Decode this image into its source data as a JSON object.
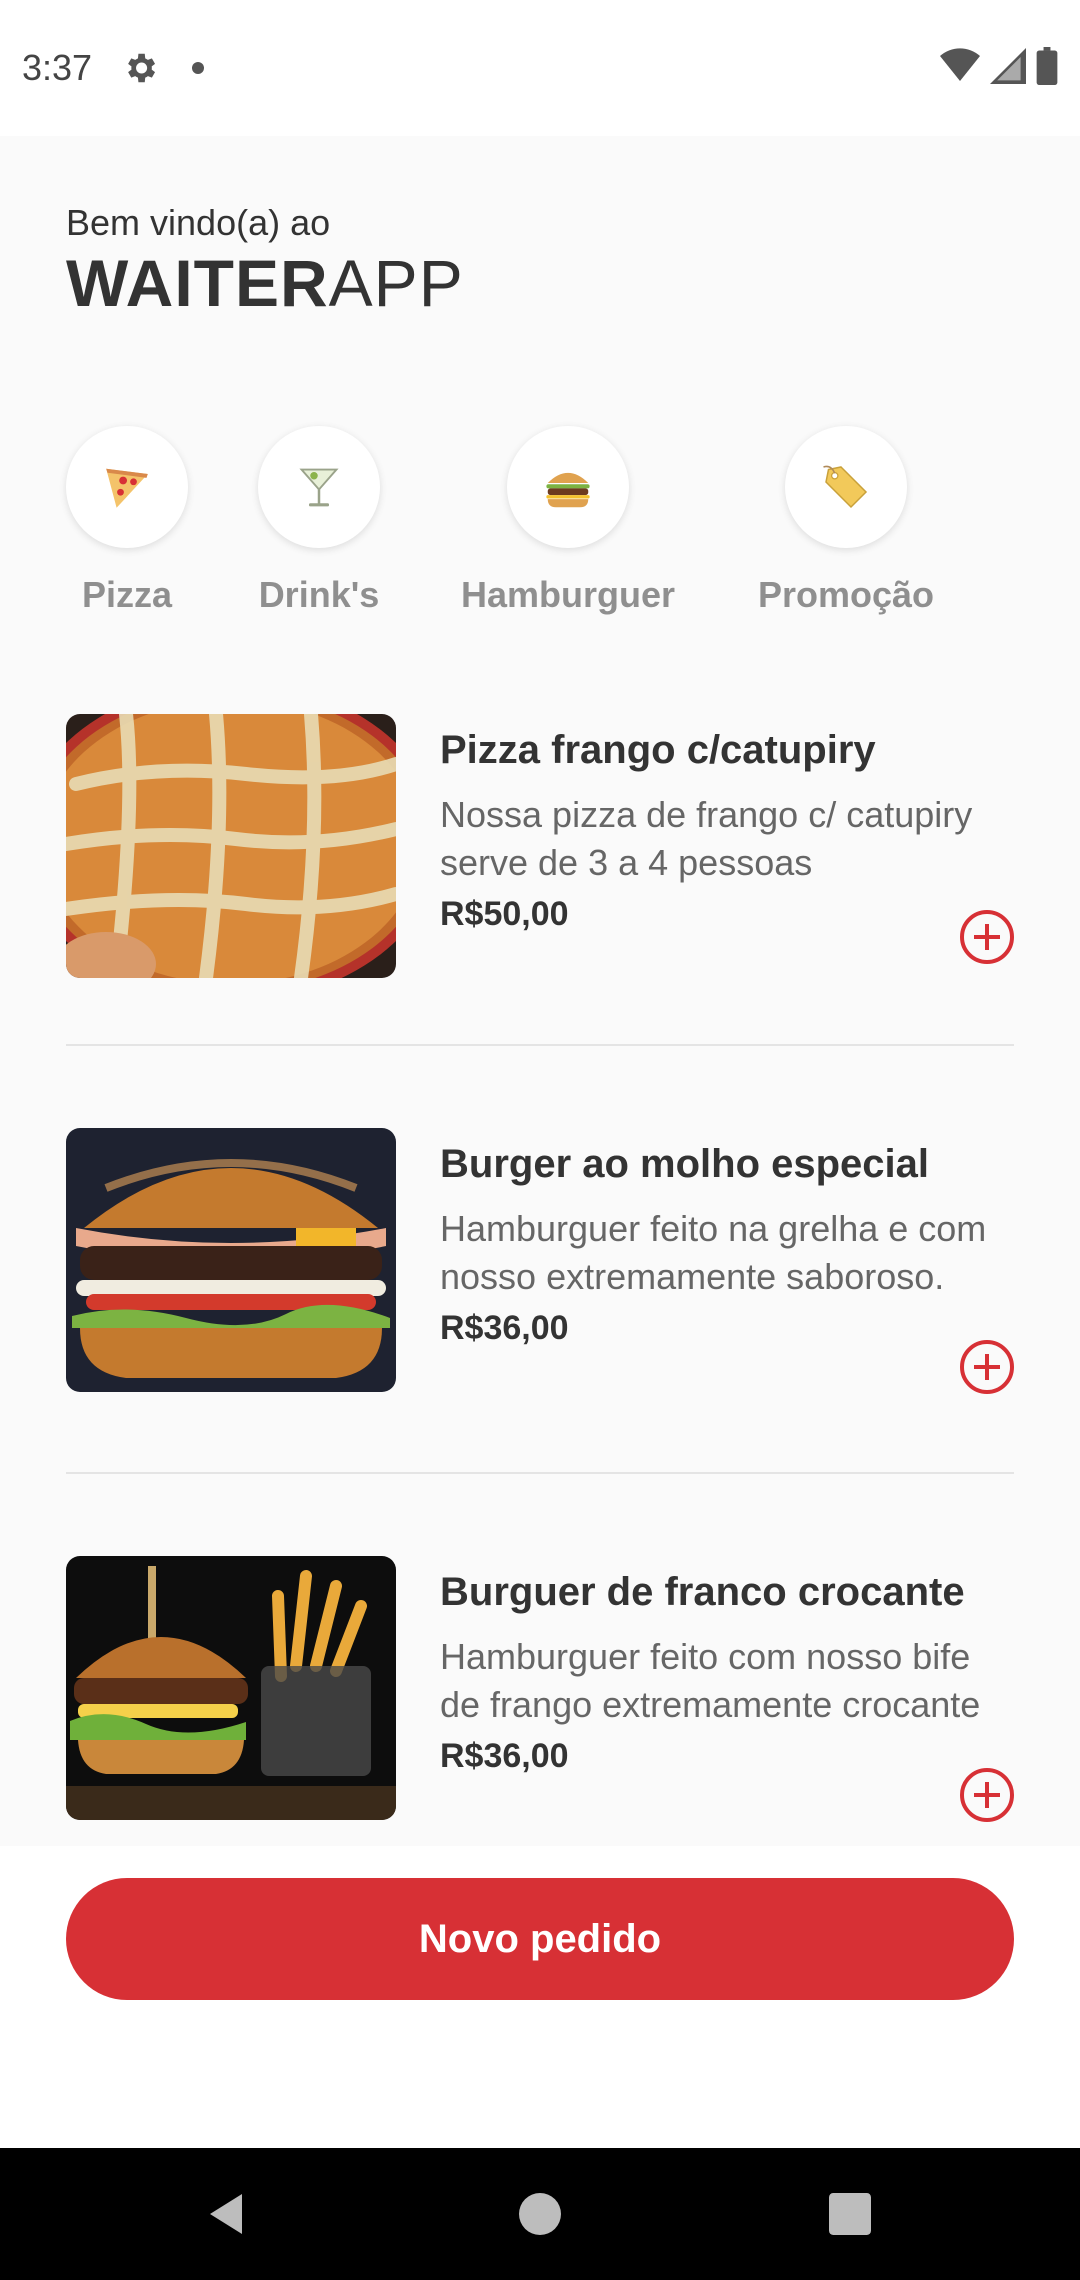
{
  "status_bar": {
    "time": "3:37",
    "icons": [
      "gear-icon",
      "dot-icon",
      "wifi-icon",
      "signal-icon",
      "battery-icon"
    ]
  },
  "header": {
    "welcome": "Bem vindo(a) ao",
    "brand_bold": "WAITER",
    "brand_light": "APP"
  },
  "categories": [
    {
      "label": "Pizza",
      "icon": "pizza-icon"
    },
    {
      "label": "Drink's",
      "icon": "cocktail-icon"
    },
    {
      "label": "Hamburguer",
      "icon": "burger-icon"
    },
    {
      "label": "Promoção",
      "icon": "tag-icon"
    }
  ],
  "products": [
    {
      "name": "Pizza frango c/catupiry",
      "description": "Nossa pizza de frango c/ catupiry serve de 3 a 4 pessoas",
      "price": "R$50,00",
      "image": "pizza-photo"
    },
    {
      "name": "Burger ao molho especial",
      "description": "Hamburguer feito na grelha e com nosso extremamente saboroso.",
      "price": "R$36,00",
      "image": "burger-photo"
    },
    {
      "name": "Burguer de franco crocante",
      "description": "Hamburguer feito com nosso bife de frango extremamente crocante",
      "price": "R$36,00",
      "image": "chicken-burger-photo"
    }
  ],
  "footer": {
    "new_order_label": "Novo pedido"
  },
  "colors": {
    "accent": "#d73035",
    "background": "#fafafa",
    "text": "#333333",
    "muted": "#666666"
  }
}
